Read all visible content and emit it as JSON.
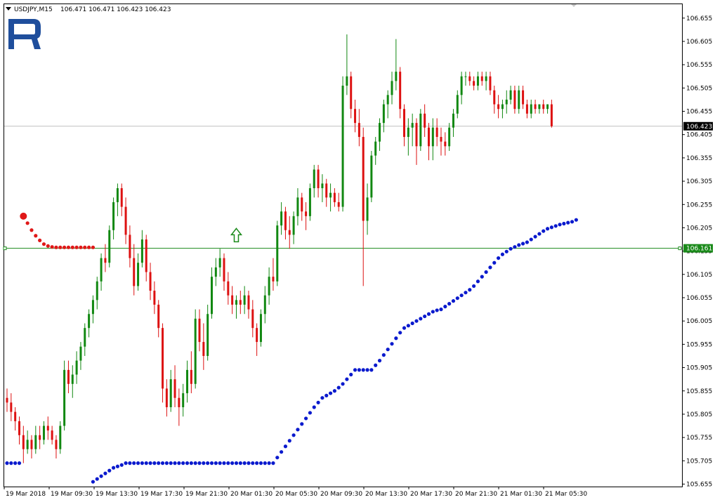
{
  "header": {
    "symbol_timeframe": "USDJPY,M15",
    "ohlc": "106.471 106.471 106.423 106.423"
  },
  "logo": {
    "icon": "roboforex-logo-icon",
    "color": "#1f4e9c"
  },
  "colors": {
    "bull": "#118811",
    "bear": "#dd1111",
    "parabolic_sar": "#0a1acd",
    "stop_line": "#e01818",
    "level_line": "#1a8a1a",
    "price_line": "#c0c0c0",
    "axis": "#000000"
  },
  "chart_data": {
    "type": "candlestick",
    "instrument": "USDJPY",
    "timeframe": "M15",
    "ylim": [
      105.655,
      106.675
    ],
    "y_ticks": [
      "106.655",
      "106.605",
      "106.555",
      "106.505",
      "106.455",
      "106.405",
      "106.355",
      "106.305",
      "106.255",
      "106.205",
      "106.155",
      "106.105",
      "106.055",
      "106.005",
      "105.955",
      "105.905",
      "105.855",
      "105.805",
      "105.755",
      "105.705",
      "105.655"
    ],
    "x_ticks": [
      "19 Mar 2018",
      "19 Mar 09:30",
      "19 Mar 13:30",
      "19 Mar 17:30",
      "19 Mar 21:30",
      "20 Mar 01:30",
      "20 Mar 05:30",
      "20 Mar 09:30",
      "20 Mar 13:30",
      "20 Mar 17:30",
      "20 Mar 21:30",
      "21 Mar 01:30",
      "21 Mar 05:30"
    ],
    "bars_count": 134,
    "current_price": "106.423",
    "level_price": "106.161",
    "candles": [
      [
        105.84,
        105.86,
        105.81,
        105.83
      ],
      [
        105.83,
        105.85,
        105.79,
        105.81
      ],
      [
        105.81,
        105.82,
        105.77,
        105.79
      ],
      [
        105.79,
        105.8,
        105.74,
        105.76
      ],
      [
        105.76,
        105.78,
        105.7,
        105.73
      ],
      [
        105.73,
        105.77,
        105.72,
        105.75
      ],
      [
        105.75,
        105.76,
        105.71,
        105.73
      ],
      [
        105.73,
        105.78,
        105.72,
        105.76
      ],
      [
        105.76,
        105.78,
        105.73,
        105.75
      ],
      [
        105.75,
        105.79,
        105.74,
        105.78
      ],
      [
        105.78,
        105.8,
        105.75,
        105.77
      ],
      [
        105.77,
        105.78,
        105.74,
        105.75
      ],
      [
        105.75,
        105.76,
        105.71,
        105.73
      ],
      [
        105.73,
        105.79,
        105.72,
        105.78
      ],
      [
        105.78,
        105.92,
        105.77,
        105.9
      ],
      [
        105.9,
        105.92,
        105.85,
        105.87
      ],
      [
        105.87,
        105.91,
        105.84,
        105.89
      ],
      [
        105.89,
        105.94,
        105.87,
        105.92
      ],
      [
        105.92,
        105.96,
        105.9,
        105.95
      ],
      [
        105.95,
        106.0,
        105.93,
        105.99
      ],
      [
        105.99,
        106.03,
        105.97,
        106.02
      ],
      [
        106.02,
        106.06,
        106.0,
        106.05
      ],
      [
        106.05,
        106.1,
        106.03,
        106.09
      ],
      [
        106.09,
        106.15,
        106.07,
        106.14
      ],
      [
        106.14,
        106.17,
        106.11,
        106.13
      ],
      [
        106.13,
        106.21,
        106.12,
        106.2
      ],
      [
        106.2,
        106.27,
        106.18,
        106.26
      ],
      [
        106.26,
        106.3,
        106.23,
        106.29
      ],
      [
        106.29,
        106.3,
        106.23,
        106.25
      ],
      [
        106.25,
        106.27,
        106.17,
        106.19
      ],
      [
        106.19,
        106.21,
        106.12,
        106.14
      ],
      [
        106.14,
        106.17,
        106.06,
        106.08
      ],
      [
        106.08,
        106.15,
        106.07,
        106.13
      ],
      [
        106.13,
        106.2,
        106.12,
        106.18
      ],
      [
        106.18,
        106.19,
        106.09,
        106.11
      ],
      [
        106.11,
        106.13,
        106.05,
        106.07
      ],
      [
        106.07,
        106.09,
        106.02,
        106.04
      ],
      [
        106.04,
        106.05,
        105.97,
        105.99
      ],
      [
        105.99,
        106.0,
        105.83,
        105.86
      ],
      [
        105.86,
        105.88,
        105.8,
        105.82
      ],
      [
        105.82,
        105.9,
        105.81,
        105.88
      ],
      [
        105.88,
        105.91,
        105.82,
        105.84
      ],
      [
        105.84,
        105.86,
        105.78,
        105.82
      ],
      [
        105.82,
        105.87,
        105.8,
        105.85
      ],
      [
        105.85,
        105.92,
        105.83,
        105.9
      ],
      [
        105.9,
        105.94,
        105.85,
        105.87
      ],
      [
        105.87,
        106.03,
        105.86,
        106.01
      ],
      [
        106.01,
        106.03,
        105.94,
        105.96
      ],
      [
        105.96,
        106.0,
        105.9,
        105.93
      ],
      [
        105.93,
        106.04,
        105.92,
        106.02
      ],
      [
        106.02,
        106.12,
        106.01,
        106.1
      ],
      [
        106.1,
        106.14,
        106.08,
        106.12
      ],
      [
        106.12,
        106.16,
        106.1,
        106.14
      ],
      [
        106.14,
        106.15,
        106.07,
        106.09
      ],
      [
        106.09,
        106.11,
        106.04,
        106.06
      ],
      [
        106.06,
        106.08,
        106.02,
        106.04
      ],
      [
        106.04,
        106.06,
        106.01,
        106.05
      ],
      [
        106.05,
        106.07,
        106.02,
        106.04
      ],
      [
        106.04,
        106.08,
        106.02,
        106.06
      ],
      [
        106.06,
        106.07,
        106.01,
        106.03
      ],
      [
        106.03,
        106.05,
        105.97,
        105.99
      ],
      [
        105.99,
        106.0,
        105.93,
        105.96
      ],
      [
        105.96,
        106.03,
        105.95,
        106.02
      ],
      [
        106.02,
        106.08,
        106.0,
        106.06
      ],
      [
        106.06,
        106.12,
        106.04,
        106.1
      ],
      [
        106.1,
        106.14,
        106.07,
        106.09
      ],
      [
        106.09,
        106.22,
        106.08,
        106.21
      ],
      [
        106.21,
        106.26,
        106.19,
        106.24
      ],
      [
        106.24,
        106.25,
        106.18,
        106.2
      ],
      [
        106.2,
        106.23,
        106.16,
        106.19
      ],
      [
        106.19,
        106.24,
        106.17,
        106.23
      ],
      [
        106.23,
        106.29,
        106.21,
        106.27
      ],
      [
        106.27,
        106.28,
        106.22,
        106.24
      ],
      [
        106.24,
        106.26,
        106.2,
        106.23
      ],
      [
        106.23,
        106.3,
        106.22,
        106.29
      ],
      [
        106.29,
        106.34,
        106.27,
        106.33
      ],
      [
        106.33,
        106.34,
        106.27,
        106.29
      ],
      [
        106.29,
        106.32,
        106.26,
        106.3
      ],
      [
        106.3,
        106.31,
        106.25,
        106.27
      ],
      [
        106.27,
        106.3,
        106.24,
        106.28
      ],
      [
        106.28,
        106.29,
        106.25,
        106.26
      ],
      [
        106.26,
        106.28,
        106.24,
        106.25
      ],
      [
        106.25,
        106.53,
        106.24,
        106.51
      ],
      [
        106.51,
        106.62,
        106.49,
        106.53
      ],
      [
        106.53,
        106.54,
        106.44,
        106.46
      ],
      [
        106.46,
        106.48,
        106.41,
        106.43
      ],
      [
        106.43,
        106.46,
        106.38,
        106.4
      ],
      [
        106.4,
        106.42,
        106.08,
        106.22
      ],
      [
        106.22,
        106.3,
        106.19,
        106.27
      ],
      [
        106.27,
        106.37,
        106.26,
        106.36
      ],
      [
        106.36,
        106.4,
        106.34,
        106.39
      ],
      [
        106.39,
        106.44,
        106.37,
        106.43
      ],
      [
        106.43,
        106.48,
        106.41,
        106.47
      ],
      [
        106.47,
        106.5,
        106.44,
        106.49
      ],
      [
        106.49,
        106.54,
        106.47,
        106.52
      ],
      [
        106.52,
        106.61,
        106.5,
        106.54
      ],
      [
        106.54,
        106.55,
        106.44,
        106.46
      ],
      [
        106.46,
        106.47,
        106.38,
        106.4
      ],
      [
        106.4,
        106.44,
        106.36,
        106.42
      ],
      [
        106.42,
        106.45,
        106.38,
        106.43
      ],
      [
        106.43,
        106.44,
        106.34,
        106.38
      ],
      [
        106.38,
        106.46,
        106.37,
        106.45
      ],
      [
        106.45,
        106.47,
        106.4,
        106.42
      ],
      [
        106.42,
        106.43,
        106.35,
        106.38
      ],
      [
        106.38,
        106.44,
        106.35,
        106.42
      ],
      [
        106.42,
        106.44,
        106.38,
        106.4
      ],
      [
        106.4,
        106.42,
        106.36,
        106.39
      ],
      [
        106.39,
        106.41,
        106.36,
        106.38
      ],
      [
        106.38,
        106.43,
        106.37,
        106.42
      ],
      [
        106.42,
        106.46,
        106.4,
        106.45
      ],
      [
        106.45,
        106.5,
        106.44,
        106.49
      ],
      [
        106.49,
        106.54,
        106.47,
        106.53
      ],
      [
        106.53,
        106.54,
        106.51,
        106.53
      ],
      [
        106.53,
        106.54,
        106.51,
        106.52
      ],
      [
        106.52,
        106.53,
        106.5,
        106.51
      ],
      [
        106.51,
        106.54,
        106.5,
        106.53
      ],
      [
        106.53,
        106.54,
        106.51,
        106.52
      ],
      [
        106.52,
        106.54,
        106.5,
        106.53
      ],
      [
        106.53,
        106.54,
        106.49,
        106.5
      ],
      [
        106.5,
        106.51,
        106.45,
        106.47
      ],
      [
        106.47,
        106.49,
        106.44,
        106.46
      ],
      [
        106.46,
        106.48,
        106.44,
        106.47
      ],
      [
        106.47,
        106.5,
        106.45,
        106.48
      ],
      [
        106.48,
        106.51,
        106.47,
        106.5
      ],
      [
        106.5,
        106.51,
        106.45,
        106.46
      ],
      [
        106.46,
        106.51,
        106.45,
        106.5
      ],
      [
        106.5,
        106.51,
        106.46,
        106.47
      ],
      [
        106.47,
        106.48,
        106.44,
        106.45
      ],
      [
        106.45,
        106.48,
        106.44,
        106.47
      ],
      [
        106.47,
        106.48,
        106.45,
        106.46
      ],
      [
        106.46,
        106.47,
        106.45,
        106.47
      ],
      [
        106.47,
        106.48,
        106.45,
        106.46
      ],
      [
        106.46,
        106.47,
        106.45,
        106.47
      ],
      [
        106.47,
        106.48,
        106.42,
        106.423
      ]
    ],
    "sar_points": [
      [
        0,
        105.7
      ],
      [
        1,
        105.7
      ],
      [
        2,
        105.7
      ],
      [
        3,
        105.7
      ],
      [
        21,
        105.66
      ],
      [
        22,
        105.666
      ],
      [
        23,
        105.672
      ],
      [
        24,
        105.678
      ],
      [
        25,
        105.684
      ],
      [
        26,
        105.69
      ],
      [
        27,
        105.693
      ],
      [
        28,
        105.696
      ],
      [
        29,
        105.7
      ],
      [
        30,
        105.7
      ],
      [
        31,
        105.7
      ],
      [
        32,
        105.7
      ],
      [
        33,
        105.7
      ],
      [
        34,
        105.7
      ],
      [
        35,
        105.7
      ],
      [
        36,
        105.7
      ],
      [
        37,
        105.7
      ],
      [
        38,
        105.7
      ],
      [
        39,
        105.7
      ],
      [
        40,
        105.7
      ],
      [
        41,
        105.7
      ],
      [
        42,
        105.7
      ],
      [
        43,
        105.7
      ],
      [
        44,
        105.7
      ],
      [
        45,
        105.7
      ],
      [
        46,
        105.7
      ],
      [
        47,
        105.7
      ],
      [
        48,
        105.7
      ],
      [
        49,
        105.7
      ],
      [
        50,
        105.7
      ],
      [
        51,
        105.7
      ],
      [
        52,
        105.7
      ],
      [
        53,
        105.7
      ],
      [
        54,
        105.7
      ],
      [
        55,
        105.7
      ],
      [
        56,
        105.7
      ],
      [
        57,
        105.7
      ],
      [
        58,
        105.7
      ],
      [
        59,
        105.7
      ],
      [
        60,
        105.7
      ],
      [
        61,
        105.7
      ],
      [
        62,
        105.7
      ],
      [
        63,
        105.7
      ],
      [
        64,
        105.7
      ],
      [
        65,
        105.7
      ],
      [
        66,
        105.712
      ],
      [
        67,
        105.724
      ],
      [
        68,
        105.736
      ],
      [
        69,
        105.748
      ],
      [
        70,
        105.76
      ],
      [
        71,
        105.772
      ],
      [
        72,
        105.784
      ],
      [
        73,
        105.796
      ],
      [
        74,
        105.808
      ],
      [
        75,
        105.82
      ],
      [
        76,
        105.83
      ],
      [
        77,
        105.84
      ],
      [
        78,
        105.845
      ],
      [
        79,
        105.85
      ],
      [
        80,
        105.855
      ],
      [
        81,
        105.862
      ],
      [
        82,
        105.87
      ],
      [
        83,
        105.88
      ],
      [
        84,
        105.89
      ],
      [
        85,
        105.9
      ],
      [
        86,
        105.9
      ],
      [
        87,
        105.9
      ],
      [
        88,
        105.9
      ],
      [
        89,
        105.9
      ],
      [
        90,
        105.91
      ],
      [
        91,
        105.92
      ],
      [
        92,
        105.932
      ],
      [
        93,
        105.944
      ],
      [
        94,
        105.956
      ],
      [
        95,
        105.968
      ],
      [
        96,
        105.98
      ],
      [
        97,
        105.99
      ],
      [
        98,
        105.995
      ],
      [
        99,
        106.0
      ],
      [
        100,
        106.005
      ],
      [
        101,
        106.01
      ],
      [
        102,
        106.015
      ],
      [
        103,
        106.02
      ],
      [
        104,
        106.025
      ],
      [
        105,
        106.028
      ],
      [
        106,
        106.03
      ],
      [
        107,
        106.036
      ],
      [
        108,
        106.042
      ],
      [
        109,
        106.048
      ],
      [
        110,
        106.054
      ],
      [
        111,
        106.06
      ],
      [
        112,
        106.066
      ],
      [
        113,
        106.072
      ],
      [
        114,
        106.08
      ],
      [
        115,
        106.09
      ],
      [
        116,
        106.1
      ],
      [
        117,
        106.11
      ],
      [
        118,
        106.12
      ],
      [
        119,
        106.13
      ],
      [
        120,
        106.14
      ],
      [
        121,
        106.148
      ],
      [
        122,
        106.154
      ],
      [
        123,
        106.16
      ],
      [
        124,
        106.164
      ],
      [
        125,
        106.168
      ],
      [
        126,
        106.171
      ],
      [
        127,
        106.174
      ],
      [
        128,
        106.18
      ],
      [
        129,
        106.186
      ],
      [
        130,
        106.192
      ],
      [
        131,
        106.198
      ],
      [
        132,
        106.203
      ],
      [
        133,
        106.206
      ],
      [
        134,
        106.209
      ],
      [
        135,
        106.212
      ],
      [
        136,
        106.214
      ],
      [
        137,
        106.216
      ],
      [
        138,
        106.218
      ],
      [
        139,
        106.222
      ]
    ],
    "stop_points": [
      [
        4,
        106.23
      ],
      [
        5,
        106.215
      ],
      [
        6,
        106.2
      ],
      [
        7,
        106.188
      ],
      [
        8,
        106.178
      ],
      [
        9,
        106.17
      ],
      [
        10,
        106.166
      ],
      [
        11,
        106.164
      ],
      [
        12,
        106.163
      ],
      [
        13,
        106.163
      ],
      [
        14,
        106.163
      ],
      [
        15,
        106.163
      ],
      [
        16,
        106.163
      ],
      [
        17,
        106.163
      ],
      [
        18,
        106.163
      ],
      [
        19,
        106.163
      ],
      [
        20,
        106.163
      ],
      [
        21,
        106.163
      ]
    ],
    "buy_arrow": {
      "bar": 56,
      "price": 106.19
    }
  }
}
